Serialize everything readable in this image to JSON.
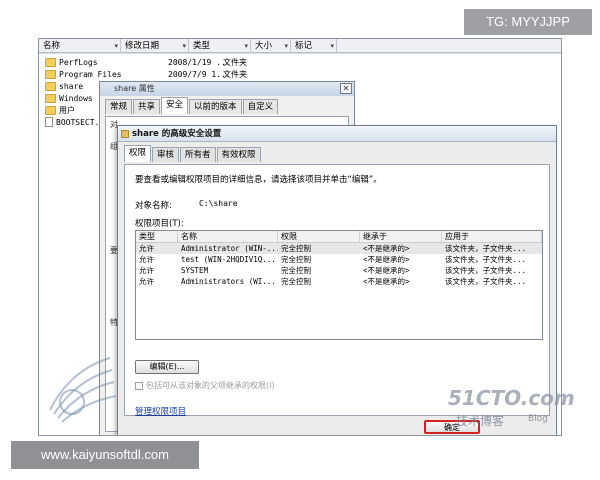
{
  "explorer": {
    "columns": [
      "名称",
      "修改日期",
      "类型",
      "大小",
      "标记"
    ],
    "files": [
      {
        "name": "PerfLogs",
        "date": "2008/1/19 ...",
        "type": "文件夹",
        "kind": "folder"
      },
      {
        "name": "Program Files",
        "date": "2009/7/9 1...",
        "type": "文件夹",
        "kind": "folder"
      },
      {
        "name": "share",
        "date": "",
        "type": "",
        "kind": "folder"
      },
      {
        "name": "Windows",
        "date": "",
        "type": "",
        "kind": "folder"
      },
      {
        "name": "用户",
        "date": "",
        "type": "",
        "kind": "folder"
      },
      {
        "name": "BOOTSECT.",
        "date": "",
        "type": "",
        "kind": "file"
      }
    ]
  },
  "props_dialog": {
    "title": "share 属性",
    "tabs": [
      "常规",
      "共享",
      "安全",
      "以前的版本",
      "自定义"
    ],
    "active_tab": "安全",
    "gutter_labels": [
      "对",
      "组",
      "要",
      "特"
    ]
  },
  "adv_dialog": {
    "title": "share 的高级安全设置",
    "tabs": [
      "权限",
      "审核",
      "所有者",
      "有效权限"
    ],
    "active_tab": "权限",
    "description": "要查看或编辑权限项目的详细信息，请选择该项目并单击“编辑”。",
    "object_label": "对象名称:",
    "object_value": "C:\\share",
    "entries_label": "权限项目(T):",
    "table": {
      "headers": [
        "类型",
        "名称",
        "权限",
        "继承于",
        "应用于"
      ],
      "rows": [
        [
          "允许",
          "Administrator (WIN-...",
          "完全控制",
          "<不是继承的>",
          "该文件夹，子文件夹..."
        ],
        [
          "允许",
          "test (WIN-2HQDIV1Q...",
          "完全控制",
          "<不是继承的>",
          "该文件夹，子文件夹..."
        ],
        [
          "允许",
          "SYSTEM",
          "完全控制",
          "<不是继承的>",
          "该文件夹，子文件夹..."
        ],
        [
          "允许",
          "Administrators (WI...",
          "完全控制",
          "<不是继承的>",
          "该文件夹，子文件夹..."
        ]
      ]
    },
    "edit_button": "编辑(E)...",
    "inherit_checkbox": "包括可从该对象的父项继承的权限(I)",
    "manage_link": "管理权限项目",
    "ok_button": "确定"
  },
  "overlays": {
    "tg_tag": "TG: MYYJJPP",
    "site_tag": "www.kaiyunsoftdl.com",
    "watermark_main": "51CTO.com",
    "watermark_sub": "技术博客",
    "watermark_blog": "Blog"
  }
}
